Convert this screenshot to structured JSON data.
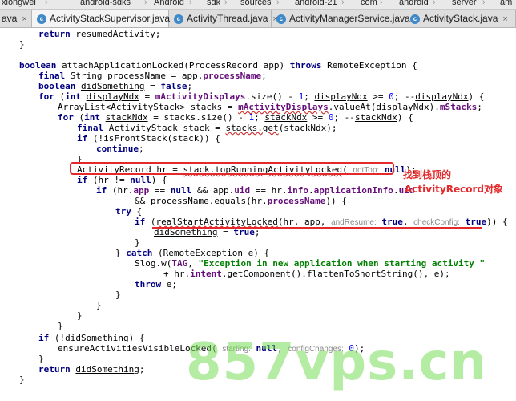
{
  "breadcrumb": {
    "items": [
      "xiongwei",
      "android-sdks",
      "Android",
      "sdk",
      "sources",
      "android-21",
      "com",
      "android",
      "server",
      "am"
    ]
  },
  "tabs": [
    {
      "label": "ActivityStackSupervisor.java",
      "active": true
    },
    {
      "label": "ActivityThread.java",
      "active": false
    },
    {
      "label": "ActivityManagerService.java",
      "active": false
    },
    {
      "label": "ActivityStack.java",
      "active": false
    }
  ],
  "code": {
    "l1": {
      "kw": "return",
      "id": "resumedActivity",
      "end": ";"
    },
    "l2": "}",
    "l3": {
      "kw": "boolean",
      "name": "attachApplicationLocked",
      "params": "(ProcessRecord app) ",
      "throws": "throws",
      "rest": " RemoteException {"
    },
    "l4": {
      "kw": "final",
      "a": " String processName = app.",
      "fld": "processName",
      "end": ";"
    },
    "l5": {
      "kw": "boolean",
      "id": "didSomething",
      "eq": " = ",
      "val": "false",
      "end": ";"
    },
    "l6": {
      "kw": "for",
      "a": " (",
      "kw2": "int",
      "id": "displayNdx",
      "b": " = ",
      "fld": "mActivityDisplays",
      "c": ".size() - ",
      "n1": "1",
      "d": "; ",
      "id2": "displayNdx",
      "e": " >= ",
      "n2": "0",
      "f": "; --",
      "id3": "displayNdx",
      "g": ") {"
    },
    "l7": {
      "a": "ArrayList<ActivityStack> stacks = ",
      "fld": "mActivityDisplays",
      "b": ".valueAt(displayNdx).",
      "fld2": "mStacks",
      "end": ";"
    },
    "l8": {
      "kw": "for",
      "a": " (",
      "kw2": "int",
      "id": "stackNdx",
      "b": " = stacks.size() - ",
      "n1": "1",
      "c": "; ",
      "id2": "stackNdx",
      "d": " >= ",
      "n2": "0",
      "e": "; --",
      "id3": "stackNdx",
      "f": ") {"
    },
    "l9": {
      "kw": "final",
      "a": " ActivityStack stack = ",
      "call": "stacks.get",
      "b": "(stackNdx);"
    },
    "l10": {
      "kw": "if",
      "a": " (!isFrontStack(stack)) {"
    },
    "l11": {
      "kw": "continue",
      "end": ";"
    },
    "l12": "}",
    "l13": {
      "a": "ActivityRecord hr = ",
      "call": "stack.topRunningActivityLocked",
      "b": "( ",
      "hint": "notTop:",
      "val": "null",
      "end": ");"
    },
    "l14": {
      "kw": "if",
      "a": " (hr != ",
      "val": "null",
      "b": ") {"
    },
    "l15": {
      "kw": "if",
      "a": " (hr.",
      "fld": "app",
      "b": " == ",
      "val": "null",
      "c": " && app.",
      "fld2": "uid",
      "d": " == hr.",
      "fld3": "info",
      "e": ".",
      "fld4": "applicationInfo",
      "f": ".",
      "fld5": "uid"
    },
    "l16": {
      "a": "&& processName.equals(hr.",
      "fld": "processName",
      "b": ")) {"
    },
    "l17": {
      "kw": "try",
      "a": " {"
    },
    "l18": {
      "kw": "if",
      "a": " (",
      "call": "realStartActivityLocked",
      "b": "(hr, app, ",
      "hint1": "andResume:",
      "val1": "true",
      "c": ", ",
      "hint2": "checkConfig:",
      "val2": "true",
      "d": ")) {"
    },
    "l19": {
      "id": "didSomething",
      "a": " = ",
      "val": "true",
      "end": ";"
    },
    "l20": "}",
    "l21": {
      "a": "} ",
      "kw": "catch",
      "b": " (RemoteException e) {"
    },
    "l22": {
      "cls": "Slog",
      "a": ".w(",
      "fld": "TAG",
      "b": ", ",
      "str": "\"Exception in new application when starting activity \""
    },
    "l23": {
      "a": "+ hr.",
      "fld": "intent",
      "b": ".getComponent().flattenToShortString(), e);"
    },
    "l24": {
      "kw": "throw",
      "a": " e;"
    },
    "l25": "}",
    "l26": "}",
    "l27": "}",
    "l28": "}",
    "l29": {
      "kw": "if",
      "a": " (!",
      "id": "didSomething",
      "b": ") {"
    },
    "l30": {
      "a": "ensureActivitiesVisibleLocked( ",
      "hint1": "starting:",
      "val1": "null",
      "b": ", ",
      "hint2": "configChanges:",
      "n": "0",
      "end": ");"
    },
    "l31": "}",
    "l32": {
      "kw": "return",
      "id": "didSomething",
      "end": ";"
    },
    "l33": "}"
  },
  "annotation": {
    "line1": "找到栈顶的",
    "line2": "ActivityRecord对象"
  },
  "watermark": "857vps.cn",
  "colors": {
    "highlight": "#e3292b",
    "keyword": "#000080",
    "field": "#660e7a",
    "string": "#008000",
    "watermark": "#78dc5a"
  }
}
